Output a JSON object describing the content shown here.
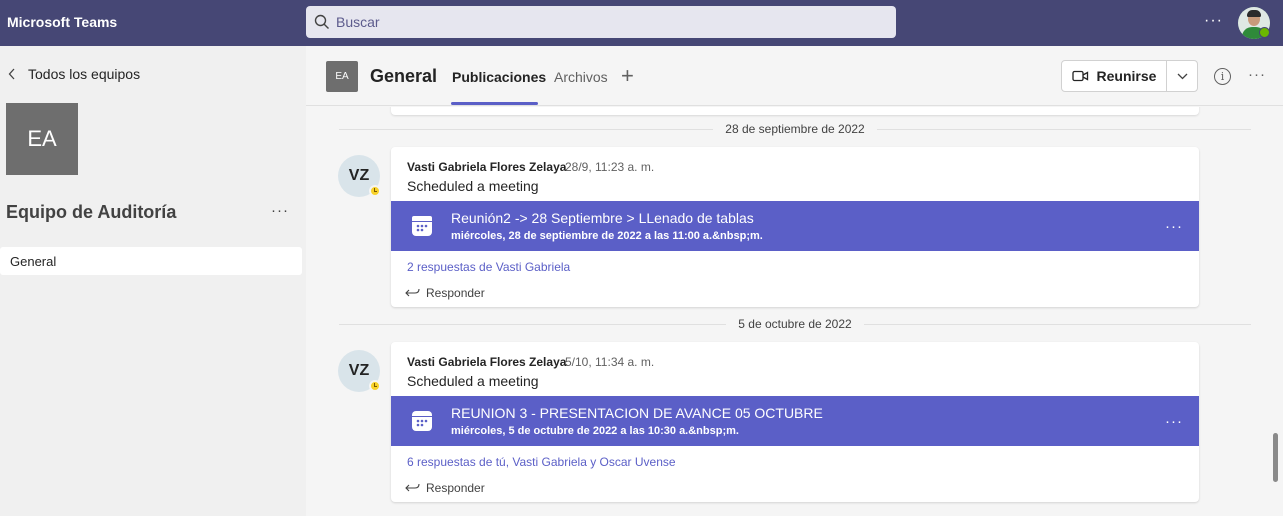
{
  "app": {
    "title": "Microsoft Teams"
  },
  "search": {
    "placeholder": "Buscar"
  },
  "sidebar": {
    "back_label": "Todos los equipos",
    "team_initials": "EA",
    "team_name": "Equipo de Auditoría",
    "channels": [
      {
        "label": "General"
      }
    ]
  },
  "header": {
    "channel_initials": "EA",
    "channel_name": "General",
    "tabs": [
      {
        "label": "Publicaciones"
      },
      {
        "label": "Archivos"
      }
    ],
    "meet_label": "Reunirse"
  },
  "feed": {
    "posts": [
      {
        "date": "28 de septiembre de 2022",
        "avatar": "VZ",
        "author": "Vasti Gabriela Flores Zelaya",
        "time": "28/9, 11:23 a. m.",
        "message": "Scheduled a meeting",
        "meeting_title": "Reunión2 -> 28 Septiembre > LLenado de tablas",
        "meeting_time": "miércoles, 28 de septiembre de 2022 a las 11:00 a.&nbsp;m.",
        "replies": "2 respuestas de Vasti Gabriela",
        "reply_label": "Responder"
      },
      {
        "date": "5 de octubre de 2022",
        "avatar": "VZ",
        "author": "Vasti Gabriela Flores Zelaya",
        "time": "5/10, 11:34 a. m.",
        "message": "Scheduled a meeting",
        "meeting_title": "REUNION 3 - PRESENTACION DE AVANCE 05 OCTUBRE",
        "meeting_time": "miércoles, 5 de octubre de 2022 a las 10:30 a.&nbsp;m.",
        "replies": "6 respuestas de tú, Vasti Gabriela y Oscar Uvense",
        "reply_label": "Responder"
      }
    ]
  },
  "colors": {
    "topbar": "#464775",
    "accent": "#5b5fc7",
    "presence_away": "#f8d22a",
    "presence_available": "#6bb700"
  },
  "icons": [
    "search-icon",
    "more-icon",
    "chevron-left-icon",
    "video-icon",
    "chevron-down-icon",
    "info-icon",
    "plus-icon",
    "calendar-icon",
    "reply-icon"
  ]
}
